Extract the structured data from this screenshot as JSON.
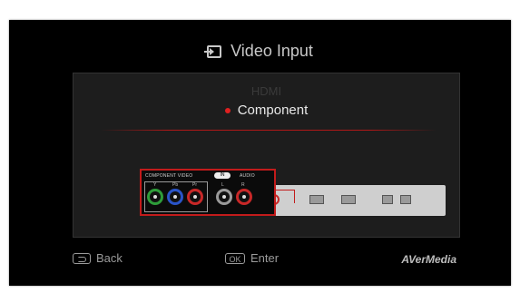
{
  "menu": {
    "title": "Video Input",
    "title_icon": "input-arrow-icon",
    "options": [
      "HDMI",
      "Component"
    ],
    "selected": "Component",
    "accent_color": "#e02020"
  },
  "diagram": {
    "callout_label_left": "COMPONENT VIDEO",
    "callout_pill": "IN",
    "callout_label_right": "AUDIO",
    "jack_labels": [
      "Y",
      "Pb",
      "Pr",
      "L",
      "R"
    ],
    "jack_colors": [
      "#2e9c3a",
      "#2a54c8",
      "#c82828",
      "#9a9a9a",
      "#c82828"
    ]
  },
  "footer": {
    "back_label": "Back",
    "back_icon": "back-arrow-icon",
    "ok_key": "OK",
    "enter_label": "Enter",
    "brand": "AVerMedia"
  }
}
